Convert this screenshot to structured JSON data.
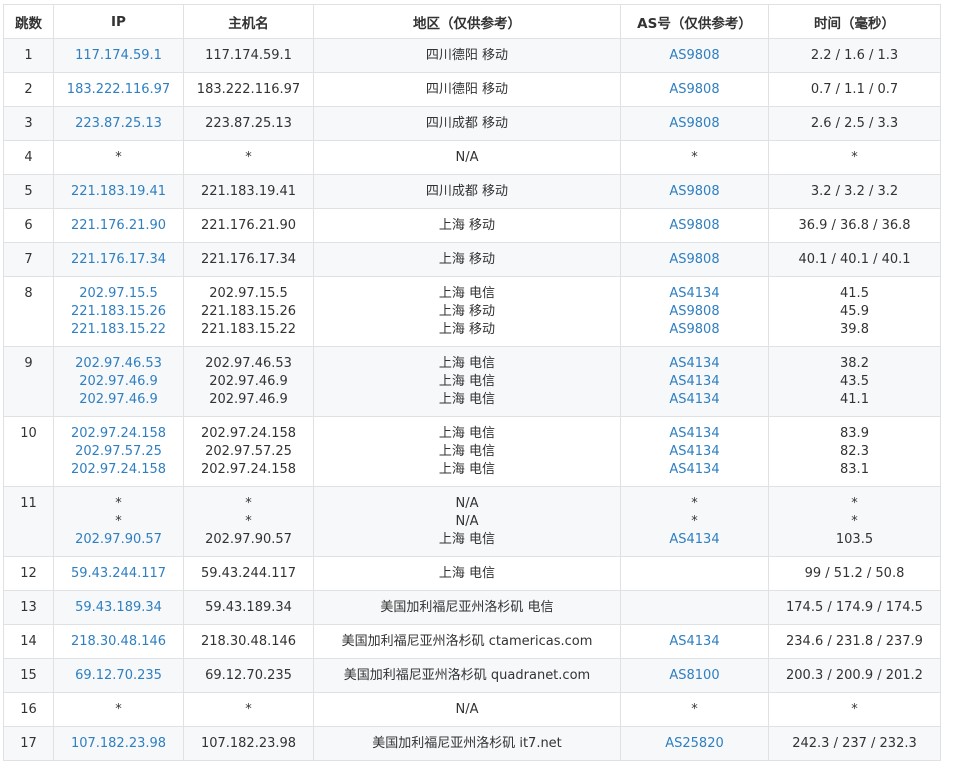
{
  "headers": [
    "跳数",
    "IP",
    "主机名",
    "地区（仅供参考）",
    "AS号（仅供参考）",
    "时间（毫秒）"
  ],
  "rows": [
    {
      "hop": "1",
      "ip": [
        "117.174.59.1"
      ],
      "host": [
        "117.174.59.1"
      ],
      "region": [
        "四川德阳 移动"
      ],
      "as": [
        "AS9808"
      ],
      "time": [
        "2.2 / 1.6 / 1.3"
      ]
    },
    {
      "hop": "2",
      "ip": [
        "183.222.116.97"
      ],
      "host": [
        "183.222.116.97"
      ],
      "region": [
        "四川德阳 移动"
      ],
      "as": [
        "AS9808"
      ],
      "time": [
        "0.7 / 1.1 / 0.7"
      ]
    },
    {
      "hop": "3",
      "ip": [
        "223.87.25.13"
      ],
      "host": [
        "223.87.25.13"
      ],
      "region": [
        "四川成都 移动"
      ],
      "as": [
        "AS9808"
      ],
      "time": [
        "2.6 / 2.5 / 3.3"
      ]
    },
    {
      "hop": "4",
      "ip": [
        "*"
      ],
      "host": [
        "*"
      ],
      "region": [
        "N/A"
      ],
      "as": [
        "*"
      ],
      "time": [
        "*"
      ]
    },
    {
      "hop": "5",
      "ip": [
        "221.183.19.41"
      ],
      "host": [
        "221.183.19.41"
      ],
      "region": [
        "四川成都 移动"
      ],
      "as": [
        "AS9808"
      ],
      "time": [
        "3.2 / 3.2 / 3.2"
      ]
    },
    {
      "hop": "6",
      "ip": [
        "221.176.21.90"
      ],
      "host": [
        "221.176.21.90"
      ],
      "region": [
        "上海 移动"
      ],
      "as": [
        "AS9808"
      ],
      "time": [
        "36.9 / 36.8 / 36.8"
      ]
    },
    {
      "hop": "7",
      "ip": [
        "221.176.17.34"
      ],
      "host": [
        "221.176.17.34"
      ],
      "region": [
        "上海 移动"
      ],
      "as": [
        "AS9808"
      ],
      "time": [
        "40.1 / 40.1 / 40.1"
      ]
    },
    {
      "hop": "8",
      "ip": [
        "202.97.15.5",
        "221.183.15.26",
        "221.183.15.22"
      ],
      "host": [
        "202.97.15.5",
        "221.183.15.26",
        "221.183.15.22"
      ],
      "region": [
        "上海 电信",
        "上海 移动",
        "上海 移动"
      ],
      "as": [
        "AS4134",
        "AS9808",
        "AS9808"
      ],
      "time": [
        "41.5",
        "45.9",
        "39.8"
      ]
    },
    {
      "hop": "9",
      "ip": [
        "202.97.46.53",
        "202.97.46.9",
        "202.97.46.9"
      ],
      "host": [
        "202.97.46.53",
        "202.97.46.9",
        "202.97.46.9"
      ],
      "region": [
        "上海 电信",
        "上海 电信",
        "上海 电信"
      ],
      "as": [
        "AS4134",
        "AS4134",
        "AS4134"
      ],
      "time": [
        "38.2",
        "43.5",
        "41.1"
      ]
    },
    {
      "hop": "10",
      "ip": [
        "202.97.24.158",
        "202.97.57.25",
        "202.97.24.158"
      ],
      "host": [
        "202.97.24.158",
        "202.97.57.25",
        "202.97.24.158"
      ],
      "region": [
        "上海 电信",
        "上海 电信",
        "上海 电信"
      ],
      "as": [
        "AS4134",
        "AS4134",
        "AS4134"
      ],
      "time": [
        "83.9",
        "82.3",
        "83.1"
      ]
    },
    {
      "hop": "11",
      "ip": [
        "*",
        "*",
        "202.97.90.57"
      ],
      "host": [
        "*",
        "*",
        "202.97.90.57"
      ],
      "region": [
        "N/A",
        "N/A",
        "上海 电信"
      ],
      "as": [
        "*",
        "*",
        "AS4134"
      ],
      "time": [
        "*",
        "*",
        "103.5"
      ]
    },
    {
      "hop": "12",
      "ip": [
        "59.43.244.117"
      ],
      "host": [
        "59.43.244.117"
      ],
      "region": [
        "上海 电信"
      ],
      "as": [
        ""
      ],
      "time": [
        "99 / 51.2 / 50.8"
      ]
    },
    {
      "hop": "13",
      "ip": [
        "59.43.189.34"
      ],
      "host": [
        "59.43.189.34"
      ],
      "region": [
        "美国加利福尼亚州洛杉矶 电信"
      ],
      "as": [
        ""
      ],
      "time": [
        "174.5 / 174.9 / 174.5"
      ]
    },
    {
      "hop": "14",
      "ip": [
        "218.30.48.146"
      ],
      "host": [
        "218.30.48.146"
      ],
      "region": [
        "美国加利福尼亚州洛杉矶 ctamericas.com"
      ],
      "as": [
        "AS4134"
      ],
      "time": [
        "234.6 / 231.8 / 237.9"
      ]
    },
    {
      "hop": "15",
      "ip": [
        "69.12.70.235"
      ],
      "host": [
        "69.12.70.235"
      ],
      "region": [
        "美国加利福尼亚州洛杉矶 quadranet.com"
      ],
      "as": [
        "AS8100"
      ],
      "time": [
        "200.3 / 200.9 / 201.2"
      ]
    },
    {
      "hop": "16",
      "ip": [
        "*"
      ],
      "host": [
        "*"
      ],
      "region": [
        "N/A"
      ],
      "as": [
        "*"
      ],
      "time": [
        "*"
      ]
    },
    {
      "hop": "17",
      "ip": [
        "107.182.23.98"
      ],
      "host": [
        "107.182.23.98"
      ],
      "region": [
        "美国加利福尼亚州洛杉矶 it7.net"
      ],
      "as": [
        "AS25820"
      ],
      "time": [
        "242.3 / 237 / 232.3"
      ]
    }
  ],
  "colors": {
    "link": "#2f7fc1",
    "text": "#333333",
    "border": "#dfe2e5",
    "stripe": "#f6f8fa"
  }
}
